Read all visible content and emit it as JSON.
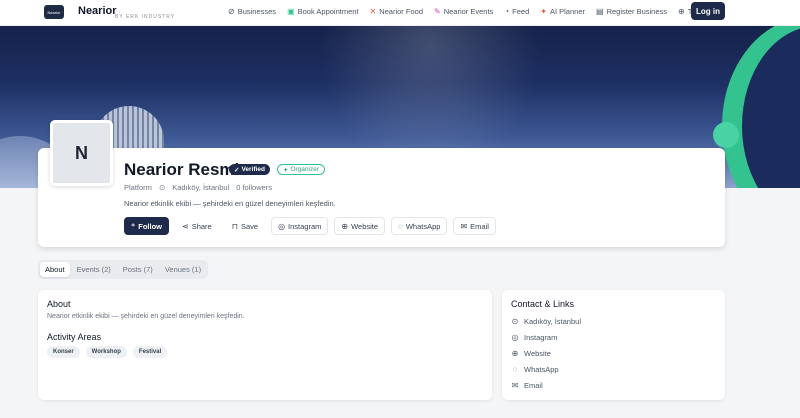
{
  "nav": {
    "brand_logo_text": "Nearior",
    "brand_name": "Nearior",
    "brand_sub": "BY ERK INDUSTRY",
    "links": [
      {
        "label": "Businesses",
        "icon": "compass-icon",
        "glyph": "⊘"
      },
      {
        "label": "Book Appointment",
        "icon": "calendar-icon",
        "glyph": "▣"
      },
      {
        "label": "Nearior Food",
        "icon": "utensils-icon",
        "glyph": "✕"
      },
      {
        "label": "Nearior Events",
        "icon": "party-icon",
        "glyph": "✎"
      },
      {
        "label": "Feed",
        "icon": "rss-icon",
        "glyph": "◔"
      },
      {
        "label": "AI Planner",
        "icon": "sparkles-icon",
        "glyph": "✦"
      },
      {
        "label": "Register Business",
        "icon": "building-icon",
        "glyph": "▤"
      },
      {
        "label": "TR",
        "icon": "globe-icon",
        "glyph": "⊕"
      }
    ],
    "login_label": "Log in"
  },
  "profile": {
    "avatar_initial": "N",
    "name": "Nearior Resmi",
    "verified_label": "Verified",
    "organizer_label": "Organizer",
    "category": "Platform",
    "location": "Kadıköy, İstanbul",
    "followers": "0 followers",
    "description": "Nearior etkinlik ekibi — şehirdeki en güzel deneyimleri keşfedin.",
    "actions": [
      {
        "label": "Follow",
        "icon": "user-plus-icon",
        "glyph": "⁺"
      },
      {
        "label": "Share",
        "icon": "share-icon",
        "glyph": "⋖"
      },
      {
        "label": "Save",
        "icon": "bookmark-icon",
        "glyph": "⊓"
      },
      {
        "label": "Instagram",
        "icon": "instagram-icon",
        "glyph": "◎"
      },
      {
        "label": "Website",
        "icon": "globe-icon",
        "glyph": "⊕"
      },
      {
        "label": "WhatsApp",
        "icon": "message-icon",
        "glyph": "◌"
      },
      {
        "label": "Email",
        "icon": "mail-icon",
        "glyph": "✉"
      }
    ]
  },
  "tabs": [
    "About",
    "Events (2)",
    "Posts (7)",
    "Venues (1)"
  ],
  "about": {
    "title": "About",
    "description": "Nearior etkinlik ekibi — şehirdeki en güzel deneyimleri keşfedin.",
    "areas_title": "Activity Areas",
    "areas": [
      "Konser",
      "Workshop",
      "Festival"
    ]
  },
  "contact": {
    "title": "Contact & Links",
    "items": [
      {
        "label": "Kadıköy, İstanbul",
        "icon": "map-pin-icon",
        "glyph": "⊙"
      },
      {
        "label": "Instagram",
        "icon": "instagram-icon",
        "glyph": "◎"
      },
      {
        "label": "Website",
        "icon": "globe-icon",
        "glyph": "⊕"
      },
      {
        "label": "WhatsApp",
        "icon": "message-icon",
        "glyph": "◌"
      },
      {
        "label": "Email",
        "icon": "mail-icon",
        "glyph": "✉"
      }
    ]
  },
  "colors": {
    "primary": "#1e2a4a",
    "accent_green": "#34c38f",
    "background": "#f4f5f7"
  }
}
